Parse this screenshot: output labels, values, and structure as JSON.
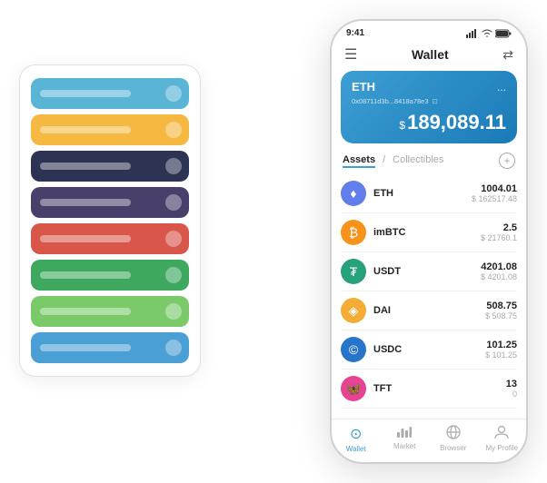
{
  "scene": {
    "cardStack": {
      "cards": [
        {
          "color": "#5ab4d6",
          "label": true,
          "icon": true
        },
        {
          "color": "#f5b942",
          "label": true,
          "icon": true
        },
        {
          "color": "#2d3352",
          "label": true,
          "icon": true
        },
        {
          "color": "#4a3f6b",
          "label": true,
          "icon": true
        },
        {
          "color": "#d9564a",
          "label": true,
          "icon": true
        },
        {
          "color": "#3da85e",
          "label": true,
          "icon": true
        },
        {
          "color": "#7bca6a",
          "label": true,
          "icon": true
        },
        {
          "color": "#4a9fd4",
          "label": true,
          "icon": true
        }
      ]
    },
    "phone": {
      "statusBar": {
        "time": "9:41",
        "battery": "100"
      },
      "header": {
        "menuIcon": "☰",
        "title": "Wallet",
        "scanIcon": "⇄"
      },
      "ethCard": {
        "coin": "ETH",
        "moreIcon": "...",
        "address": "0x08711d3b...8418a78e3",
        "copyIcon": "⊡",
        "currencySymbol": "$",
        "amount": "189,089.11"
      },
      "assetsTabs": {
        "active": "Assets",
        "inactive": "Collectibles",
        "separator": "/"
      },
      "assets": [
        {
          "symbol": "ETH",
          "iconColor": "#627eea",
          "iconText": "♦",
          "amount": "1004.01",
          "usd": "$ 162517.48"
        },
        {
          "symbol": "imBTC",
          "iconColor": "#f7931a",
          "iconText": "₿",
          "amount": "2.5",
          "usd": "$ 21760.1"
        },
        {
          "symbol": "USDT",
          "iconColor": "#26a17b",
          "iconText": "₮",
          "amount": "4201.08",
          "usd": "$ 4201.08"
        },
        {
          "symbol": "DAI",
          "iconColor": "#f5ac37",
          "iconText": "◈",
          "amount": "508.75",
          "usd": "$ 508.75"
        },
        {
          "symbol": "USDC",
          "iconColor": "#2775ca",
          "iconText": "©",
          "amount": "101.25",
          "usd": "$ 101.25"
        },
        {
          "symbol": "TFT",
          "iconColor": "#e84393",
          "iconText": "🦋",
          "amount": "13",
          "usd": "0"
        }
      ],
      "bottomNav": [
        {
          "label": "Wallet",
          "icon": "⊙",
          "active": true
        },
        {
          "label": "Market",
          "icon": "📊",
          "active": false
        },
        {
          "label": "Browser",
          "icon": "👤",
          "active": false
        },
        {
          "label": "My Profile",
          "icon": "👤",
          "active": false
        }
      ]
    }
  }
}
